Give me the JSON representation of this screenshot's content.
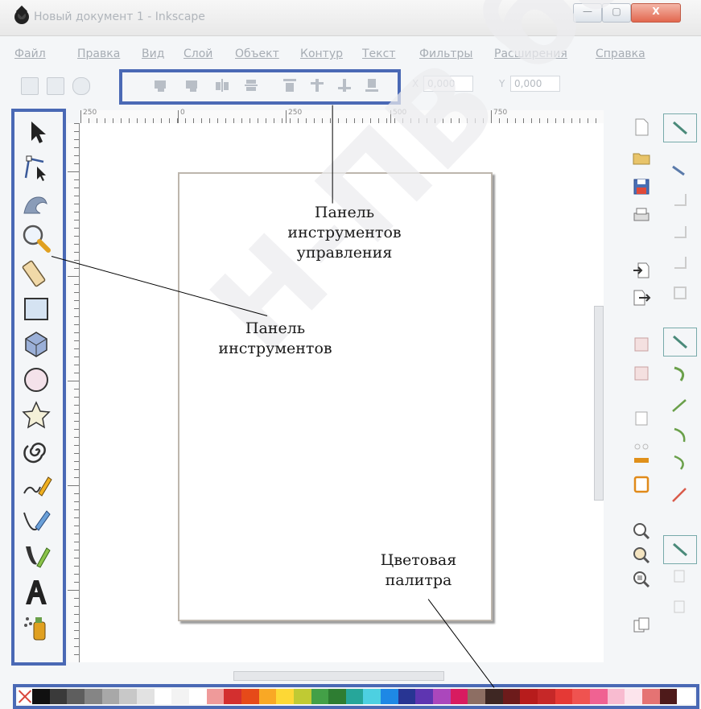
{
  "window": {
    "title": "Новый документ 1 - Inkscape",
    "minimize_glyph": "—",
    "maximize_glyph": "▢",
    "close_glyph": "X"
  },
  "menu": [
    {
      "label": "Файл"
    },
    {
      "label": "Правка"
    },
    {
      "label": "Вид"
    },
    {
      "label": "Слой"
    },
    {
      "label": "Объект"
    },
    {
      "label": "Контур"
    },
    {
      "label": "Текст"
    },
    {
      "label": "Фильтры"
    },
    {
      "label": "Расширения"
    },
    {
      "label": "Справка"
    }
  ],
  "controls": {
    "x_label": "X",
    "x_value": "0,000",
    "y_label": "Y",
    "y_value": "0,000"
  },
  "ruler": {
    "marks": [
      "250",
      "0",
      "250",
      "500",
      "750"
    ]
  },
  "annotations": {
    "controls_toolbar": [
      "Панель",
      "инструментов",
      "управления"
    ],
    "toolbox": [
      "Панель",
      "инструментов"
    ],
    "palette": [
      "Цветовая",
      "палитра"
    ]
  },
  "watermark": "Н-ПВ баспа",
  "tools": [
    {
      "icon": "selector-arrow-icon"
    },
    {
      "icon": "node-editor-icon"
    },
    {
      "icon": "tweak-icon"
    },
    {
      "icon": "zoom-icon"
    },
    {
      "icon": "measure-icon"
    },
    {
      "icon": "rectangle-icon"
    },
    {
      "icon": "3d-box-icon"
    },
    {
      "icon": "ellipse-icon"
    },
    {
      "icon": "star-icon"
    },
    {
      "icon": "spiral-icon"
    },
    {
      "icon": "pencil-icon"
    },
    {
      "icon": "pen-icon"
    },
    {
      "icon": "calligraphy-icon"
    },
    {
      "icon": "text-icon"
    },
    {
      "icon": "spray-icon"
    }
  ],
  "palette": {
    "colors": [
      "#101010",
      "#3a3a3a",
      "#5e5e5e",
      "#858585",
      "#a8a8a8",
      "#c8c8c8",
      "#e2e2e2",
      "#ffffff",
      "#f3f3f3",
      "#ffffff",
      "#ef9a9a",
      "#d32f2f",
      "#e64a19",
      "#f9a825",
      "#fdd835",
      "#c0ca33",
      "#43a047",
      "#2e7d32",
      "#26a69a",
      "#4dd0e1",
      "#1e88e5",
      "#283593",
      "#5e35b1",
      "#ab47bc",
      "#d81b60",
      "#8d6e63",
      "#3e2723",
      "#6d1b1b",
      "#b71c1c",
      "#c62828",
      "#e53935",
      "#ef5350",
      "#f06292",
      "#f8bbd0",
      "#fce4ec",
      "#e57373",
      "#4e1a1a",
      "#ffffff"
    ]
  }
}
